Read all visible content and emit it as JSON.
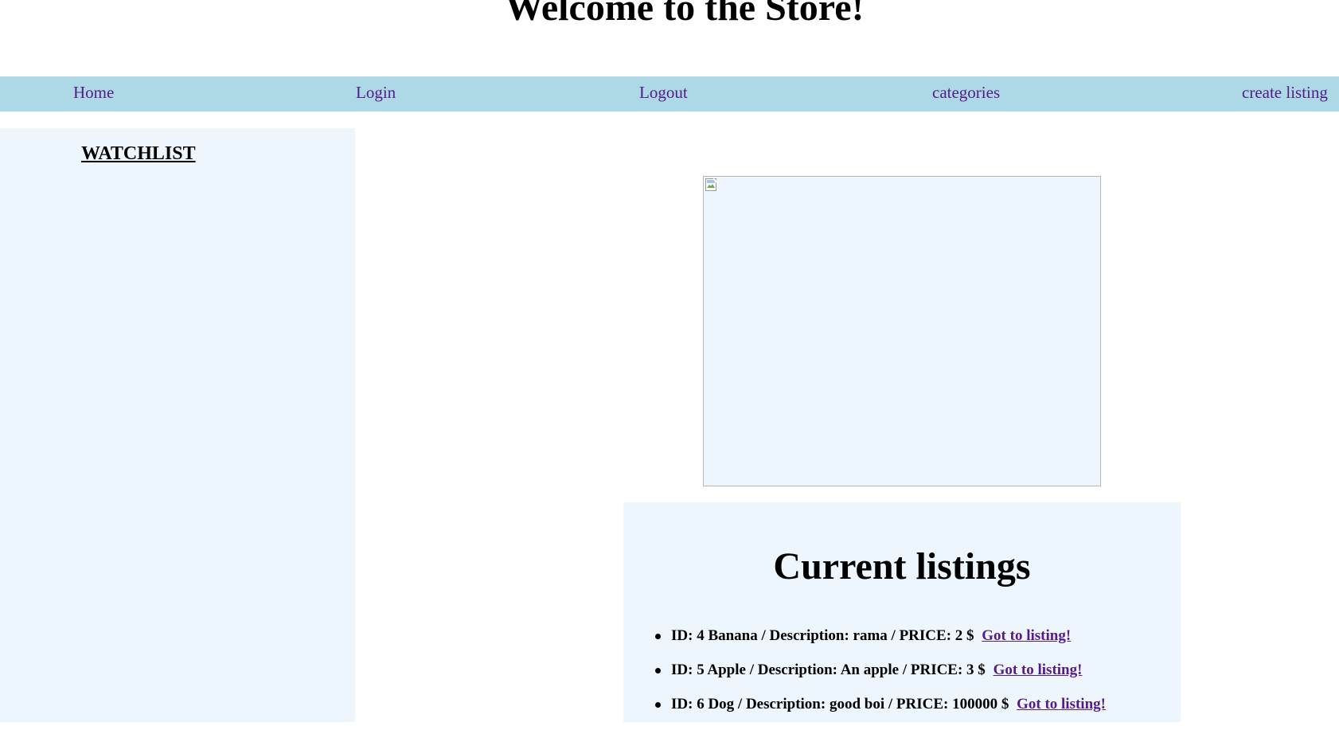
{
  "page": {
    "title": "Welcome to the Store!"
  },
  "nav": {
    "items": [
      {
        "label": "Home"
      },
      {
        "label": "Login"
      },
      {
        "label": "Logout"
      },
      {
        "label": "categories"
      },
      {
        "label": "create listing"
      }
    ]
  },
  "sidebar": {
    "watchlist_title": "WATCHLIST"
  },
  "main": {
    "image_icon": "broken-image-icon",
    "listings_title": "Current listings",
    "listings": [
      {
        "text": "ID: 4 Banana / Description: rama / PRICE: 2 $",
        "link": "Got to listing!"
      },
      {
        "text": "ID: 5 Apple / Description: An apple / PRICE: 3 $",
        "link": "Got to listing!"
      },
      {
        "text": "ID: 6 Dog / Description: good boi / PRICE: 100000 $",
        "link": "Got to listing!"
      }
    ]
  },
  "colors": {
    "navbar_bg": "#add8e6",
    "panel_bg": "#eef6fd",
    "link": "#551a8b"
  }
}
